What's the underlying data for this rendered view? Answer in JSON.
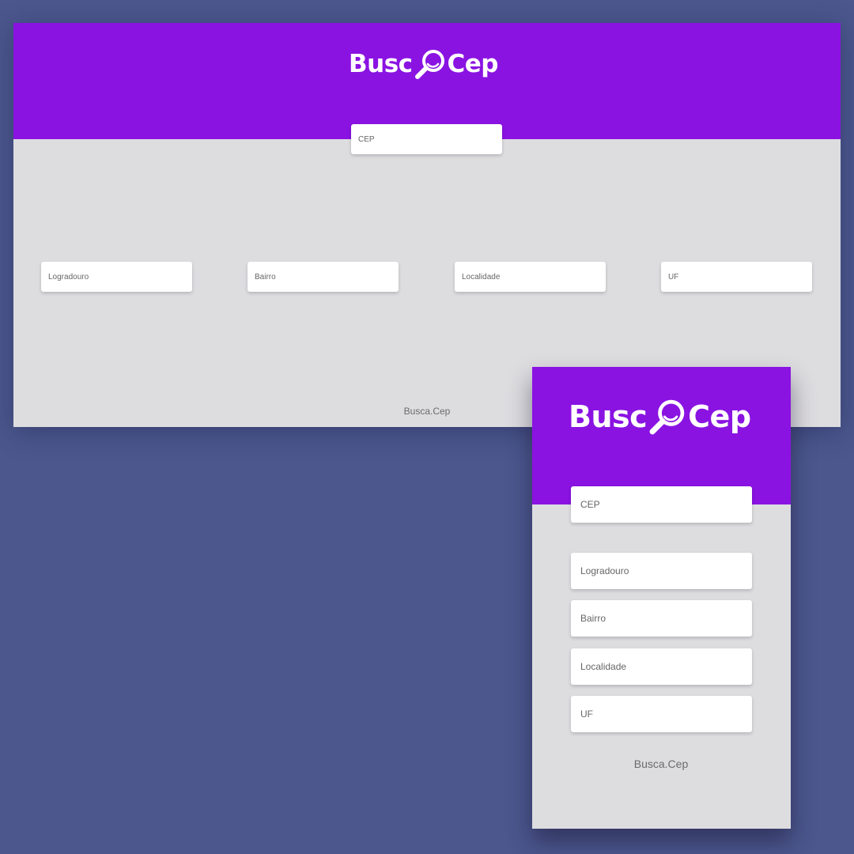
{
  "logo": {
    "left_text": "Busc",
    "right_text": "Cep",
    "icon": "magnifier-icon"
  },
  "search": {
    "cep_placeholder": "CEP"
  },
  "results": {
    "logradouro_placeholder": "Logradouro",
    "bairro_placeholder": "Bairro",
    "localidade_placeholder": "Localidade",
    "uf_placeholder": "UF"
  },
  "footer": {
    "text": "Busca.Cep"
  },
  "colors": {
    "background": "#4b578d",
    "header": "#8a13e2",
    "body": "#dddde0",
    "field": "#ffffff"
  }
}
